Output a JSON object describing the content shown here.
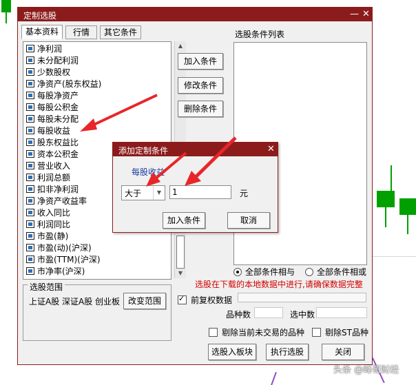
{
  "main_dialog": {
    "title": "定制选股",
    "tabs": [
      "基本资料",
      "行情",
      "其它条件"
    ],
    "list_items": [
      "净利润",
      "未分配利润",
      "少数股权",
      "净资产(股东权益)",
      "每股净资产",
      "每股公积金",
      "每股未分配",
      "每股收益",
      "股东权益比",
      "资本公积金",
      "营业收入",
      "利润总额",
      "扣非净利润",
      "净资产收益率",
      "收入同比",
      "利润同比",
      "市盈(静)",
      "市盈(动)(沪深)",
      "市盈(TTM)(沪深)",
      "市净率(沪深)"
    ],
    "selected_item": "每股收益",
    "buttons": {
      "add_condition": "加入条件",
      "modify_condition": "修改条件",
      "delete_condition": "删除条件",
      "change_range": "改变范围",
      "select_into_board": "选股入板块",
      "execute": "执行选股",
      "close": "关闭"
    },
    "selection_list_label": "选股条件列表",
    "radio_all_and": "全部条件相与",
    "radio_all_or": "全部条件相或",
    "warning": "选股在下载的本地数据中进行,请确保数据完整",
    "checkbox_restore": "前复权数据",
    "label_count": "品种数",
    "label_selected": "选中数",
    "checkbox_exclude_untraded": "剔除当前未交易的品种",
    "checkbox_exclude_st": "剔除ST品种",
    "range_group_title": "选股范围",
    "range_text": "上证A股 深证A股 创业板"
  },
  "sub_dialog": {
    "title": "添加定制条件",
    "field_label": "每股收益",
    "operator": "大于",
    "value": "1",
    "unit": "元",
    "add_button": "加入条件",
    "cancel_button": "取消"
  },
  "watermark": "头条 @峰哥财经",
  "colors": {
    "titlebar": "#8c1c1c",
    "warning": "#d40000",
    "arrow": "#e8262a",
    "candle_green": "#00a000"
  }
}
